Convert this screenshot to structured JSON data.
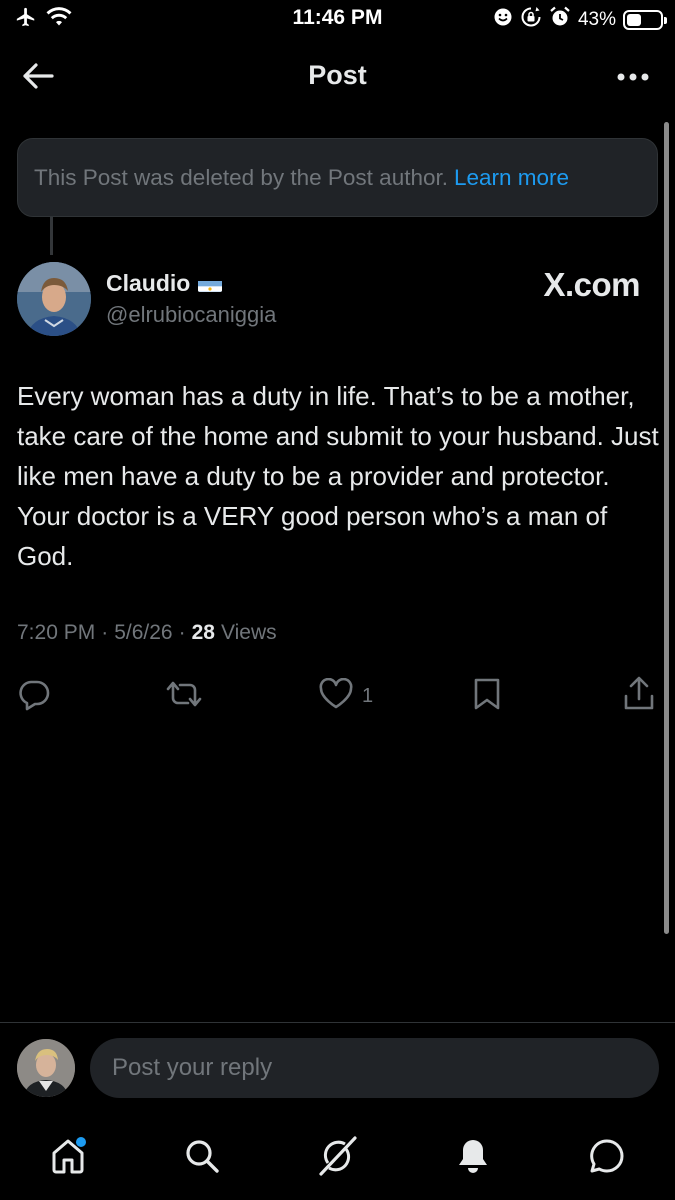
{
  "status_bar": {
    "time": "11:46 PM",
    "battery_percent": "43%",
    "battery_level": 0.43,
    "icons": [
      "airplane-icon",
      "wifi-icon",
      "face-icon",
      "rotation-lock-icon",
      "alarm-icon",
      "battery-icon"
    ]
  },
  "header": {
    "title": "Post",
    "back_icon": "arrow-left-icon",
    "more_icon": "more-dots-icon"
  },
  "deleted_notice": {
    "text": "This Post was deleted by the Post author.",
    "link": "Learn more"
  },
  "post": {
    "author_name": "Claudio",
    "author_flag": "argentina-flag-icon",
    "author_handle": "@elrubiocaniggia",
    "watermark": "X.com",
    "text": "Every woman has a duty in life. That’s to be a mother, take care of the home and submit to your husband. Just like men have a duty to be a provider and protector. Your doctor is a VERY good person who’s a man of God.",
    "time": "7:20 PM",
    "separator": "·",
    "date": "5/6/26",
    "views_count": "28",
    "views_label": "Views"
  },
  "actions": {
    "reply_icon": "reply-icon",
    "repost_icon": "repost-icon",
    "like_icon": "heart-icon",
    "like_count": "1",
    "bookmark_icon": "bookmark-icon",
    "share_icon": "share-icon"
  },
  "reply_bar": {
    "placeholder": "Post your reply"
  },
  "bottom_nav": {
    "items": [
      "home-icon",
      "search-icon",
      "grok-icon",
      "notifications-icon",
      "messages-icon"
    ]
  },
  "colors": {
    "background": "#000000",
    "text_primary": "#e7e9ea",
    "text_secondary": "#71767b",
    "accent": "#1d9bf0",
    "surface": "#202327"
  }
}
